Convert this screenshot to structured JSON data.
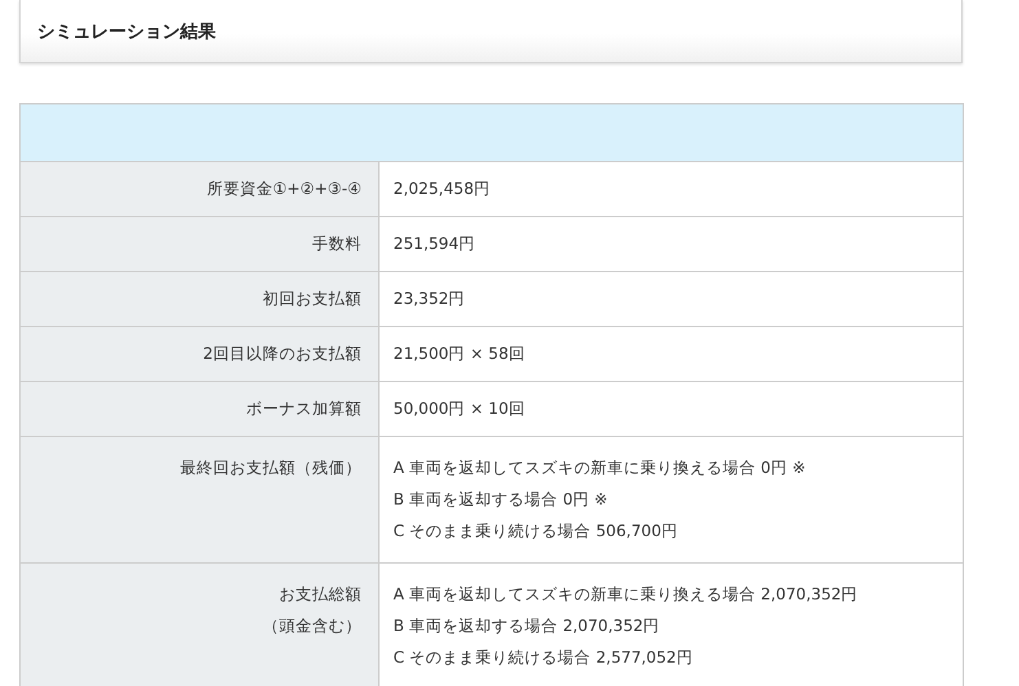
{
  "title": "シミュレーション結果",
  "rows": [
    {
      "label": [
        "所要資金①+②+③-④"
      ],
      "values": [
        "2,025,458円"
      ]
    },
    {
      "label": [
        "手数料"
      ],
      "values": [
        "251,594円"
      ]
    },
    {
      "label": [
        "初回お支払額"
      ],
      "values": [
        "23,352円"
      ]
    },
    {
      "label": [
        "2回目以降のお支払額"
      ],
      "values": [
        "21,500円 × 58回"
      ]
    },
    {
      "label": [
        "ボーナス加算額"
      ],
      "values": [
        "50,000円 × 10回"
      ]
    },
    {
      "label": [
        "最終回お支払額（残価）"
      ],
      "values": [
        "A 車両を返却してスズキの新車に乗り換える場合 0円 ※",
        "B 車両を返却する場合 0円 ※",
        "C そのまま乗り続ける場合 506,700円"
      ]
    },
    {
      "label": [
        "お支払総額",
        "（頭金含む）"
      ],
      "values": [
        "A 車両を返却してスズキの新車に乗り換える場合 2,070,352円",
        "B 車両を返却する場合 2,070,352円",
        "C そのまま乗り続ける場合 2,577,052円"
      ]
    }
  ]
}
